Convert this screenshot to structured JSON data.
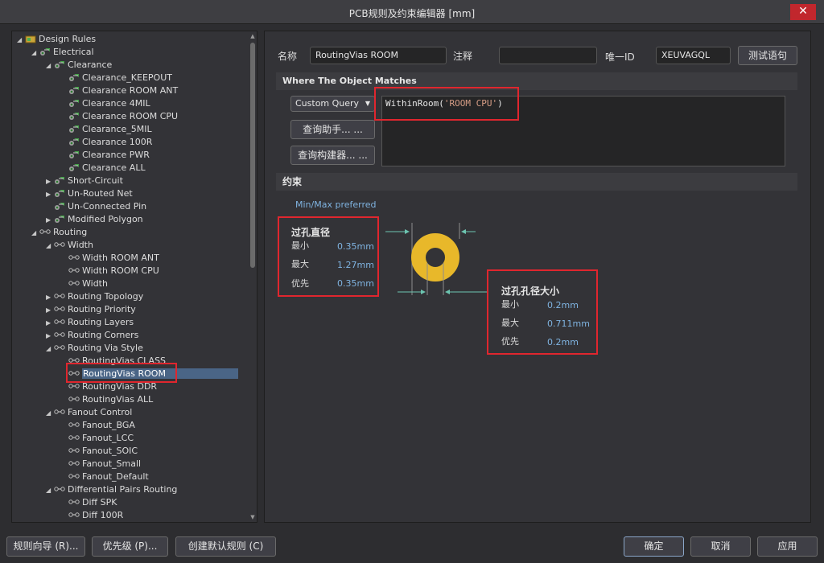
{
  "window": {
    "title": "PCB规则及约束编辑器 [mm]",
    "close_glyph": "✕"
  },
  "tree": {
    "rows": [
      {
        "label": "Design Rules",
        "depth": 0,
        "expanded": true,
        "icon": "rules-root-icon"
      },
      {
        "label": "Electrical",
        "depth": 1,
        "expanded": true,
        "icon": "rule-category-icon"
      },
      {
        "label": "Clearance",
        "depth": 2,
        "expanded": true,
        "icon": "rule-category-icon"
      },
      {
        "label": "Clearance_KEEPOUT",
        "depth": 3,
        "icon": "rule-icon"
      },
      {
        "label": "Clearance ROOM ANT",
        "depth": 3,
        "icon": "rule-icon"
      },
      {
        "label": "Clearance 4MIL",
        "depth": 3,
        "icon": "rule-icon"
      },
      {
        "label": "Clearance ROOM CPU",
        "depth": 3,
        "icon": "rule-icon"
      },
      {
        "label": "Clearance_5MIL",
        "depth": 3,
        "icon": "rule-icon"
      },
      {
        "label": "Clearance 100R",
        "depth": 3,
        "icon": "rule-icon"
      },
      {
        "label": "Clearance PWR",
        "depth": 3,
        "icon": "rule-icon"
      },
      {
        "label": "Clearance ALL",
        "depth": 3,
        "icon": "rule-icon"
      },
      {
        "label": "Short-Circuit",
        "depth": 2,
        "expanded": false,
        "icon": "rule-category-icon"
      },
      {
        "label": "Un-Routed Net",
        "depth": 2,
        "expanded": false,
        "icon": "rule-category-icon"
      },
      {
        "label": "Un-Connected Pin",
        "depth": 2,
        "icon": "rule-category-icon"
      },
      {
        "label": "Modified Polygon",
        "depth": 2,
        "expanded": false,
        "icon": "rule-category-icon"
      },
      {
        "label": "Routing",
        "depth": 1,
        "expanded": true,
        "icon": "routing-category-icon"
      },
      {
        "label": "Width",
        "depth": 2,
        "expanded": true,
        "icon": "routing-category-icon"
      },
      {
        "label": "Width ROOM ANT",
        "depth": 3,
        "icon": "routing-rule-icon"
      },
      {
        "label": "Width ROOM CPU",
        "depth": 3,
        "icon": "routing-rule-icon"
      },
      {
        "label": "Width",
        "depth": 3,
        "icon": "routing-rule-icon"
      },
      {
        "label": "Routing Topology",
        "depth": 2,
        "expanded": false,
        "icon": "routing-category-icon"
      },
      {
        "label": "Routing Priority",
        "depth": 2,
        "expanded": false,
        "icon": "routing-category-icon"
      },
      {
        "label": "Routing Layers",
        "depth": 2,
        "expanded": false,
        "icon": "routing-category-icon"
      },
      {
        "label": "Routing Corners",
        "depth": 2,
        "expanded": false,
        "icon": "routing-category-icon"
      },
      {
        "label": "Routing Via Style",
        "depth": 2,
        "expanded": true,
        "icon": "routing-category-icon"
      },
      {
        "label": "RoutingVias CLASS",
        "depth": 3,
        "icon": "routing-rule-icon"
      },
      {
        "label": "RoutingVias ROOM",
        "depth": 3,
        "icon": "routing-rule-icon",
        "selected": true
      },
      {
        "label": "RoutingVias DDR",
        "depth": 3,
        "icon": "routing-rule-icon"
      },
      {
        "label": "RoutingVias ALL",
        "depth": 3,
        "icon": "routing-rule-icon"
      },
      {
        "label": "Fanout Control",
        "depth": 2,
        "expanded": true,
        "icon": "routing-category-icon"
      },
      {
        "label": "Fanout_BGA",
        "depth": 3,
        "icon": "routing-rule-icon"
      },
      {
        "label": "Fanout_LCC",
        "depth": 3,
        "icon": "routing-rule-icon"
      },
      {
        "label": "Fanout_SOIC",
        "depth": 3,
        "icon": "routing-rule-icon"
      },
      {
        "label": "Fanout_Small",
        "depth": 3,
        "icon": "routing-rule-icon"
      },
      {
        "label": "Fanout_Default",
        "depth": 3,
        "icon": "routing-rule-icon"
      },
      {
        "label": "Differential Pairs Routing",
        "depth": 2,
        "expanded": true,
        "icon": "routing-category-icon"
      },
      {
        "label": "Diff SPK",
        "depth": 3,
        "icon": "routing-rule-icon"
      },
      {
        "label": "Diff 100R",
        "depth": 3,
        "icon": "routing-rule-icon"
      }
    ]
  },
  "rule": {
    "name_label": "名称",
    "name_value": "RoutingVias ROOM",
    "comment_label": "注释",
    "comment_value": "",
    "id_label": "唯一ID",
    "id_value": "XEUVAGQL",
    "test_button": "测试语句"
  },
  "match": {
    "section_title": "Where The Object Matches",
    "query_type": "Custom Query",
    "query_prefix": "WithinRoom(",
    "query_string": "'ROOM CPU'",
    "query_suffix": ")",
    "helper_button": "查询助手... ...",
    "builder_button": "查询构建器... ..."
  },
  "constraints": {
    "section_title": "约束",
    "mode_label": "Min/Max preferred",
    "via_diameter": {
      "title": "过孔直径",
      "min_label": "最小",
      "min_value": "0.35mm",
      "max_label": "最大",
      "max_value": "1.27mm",
      "pref_label": "优先",
      "pref_value": "0.35mm"
    },
    "hole_size": {
      "title": "过孔孔径大小",
      "min_label": "最小",
      "min_value": "0.2mm",
      "max_label": "最大",
      "max_value": "0.711mm",
      "pref_label": "优先",
      "pref_value": "0.2mm"
    },
    "via_ring_color": "#e8b82a"
  },
  "footer": {
    "rule_wizard": "规则向导 (R)...",
    "priorities": "优先级 (P)...",
    "create_default": "创建默认规则 (C)",
    "ok": "确定",
    "cancel": "取消",
    "apply": "应用"
  }
}
